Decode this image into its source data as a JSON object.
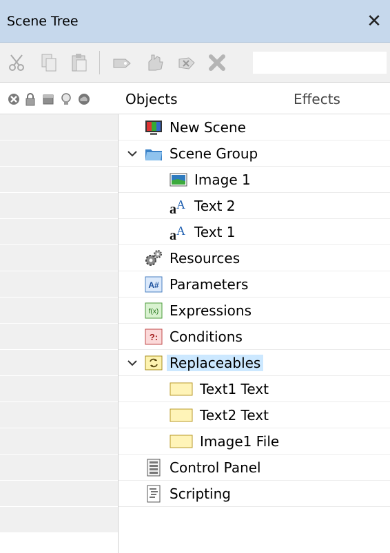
{
  "window": {
    "title": "Scene Tree",
    "close_glyph": "✕"
  },
  "toolbar": {
    "buttons": [
      "cut-icon",
      "copy-icon",
      "paste-icon",
      "tag-icon",
      "hand-icon",
      "delete-tag-icon",
      "delete-icon"
    ],
    "search_value": ""
  },
  "header": {
    "column_icons": [
      "disable-icon",
      "lock-icon",
      "layer-icon",
      "light-bulb-icon",
      "cloud-icon"
    ],
    "objects_label": "Objects",
    "effects_label": "Effects"
  },
  "tree": [
    {
      "label": "New Scene",
      "icon": "scene-icon",
      "level": 0,
      "expanded": null
    },
    {
      "label": "Scene Group",
      "icon": "folder-icon",
      "level": 0,
      "expanded": true
    },
    {
      "label": "Image 1",
      "icon": "image-icon",
      "level": 1,
      "expanded": null
    },
    {
      "label": "Text 2",
      "icon": "text-icon",
      "level": 1,
      "expanded": null
    },
    {
      "label": "Text 1",
      "icon": "text-icon",
      "level": 1,
      "expanded": null
    },
    {
      "label": "Resources",
      "icon": "gears-icon",
      "level": 0,
      "expanded": null
    },
    {
      "label": "Parameters",
      "icon": "parameters-icon",
      "level": 0,
      "expanded": null,
      "badge": "A#"
    },
    {
      "label": "Expressions",
      "icon": "expressions-icon",
      "level": 0,
      "expanded": null,
      "badge": "f(x)"
    },
    {
      "label": "Conditions",
      "icon": "conditions-icon",
      "level": 0,
      "expanded": null,
      "badge": "?:"
    },
    {
      "label": "Replaceables",
      "icon": "replaceables-icon",
      "level": 0,
      "expanded": true,
      "selected": true
    },
    {
      "label": "Text1 Text",
      "icon": "replaceable-item-icon",
      "level": 1,
      "expanded": null
    },
    {
      "label": "Text2 Text",
      "icon": "replaceable-item-icon",
      "level": 1,
      "expanded": null
    },
    {
      "label": "Image1 File",
      "icon": "replaceable-item-icon",
      "level": 1,
      "expanded": null
    },
    {
      "label": "Control Panel",
      "icon": "control-panel-icon",
      "level": 0,
      "expanded": null
    },
    {
      "label": "Scripting",
      "icon": "scripting-icon",
      "level": 0,
      "expanded": null
    }
  ],
  "colors": {
    "titlebar": "#c6d8ec",
    "selection": "#cce8ff",
    "left_col_row": "#f0f0f0"
  }
}
